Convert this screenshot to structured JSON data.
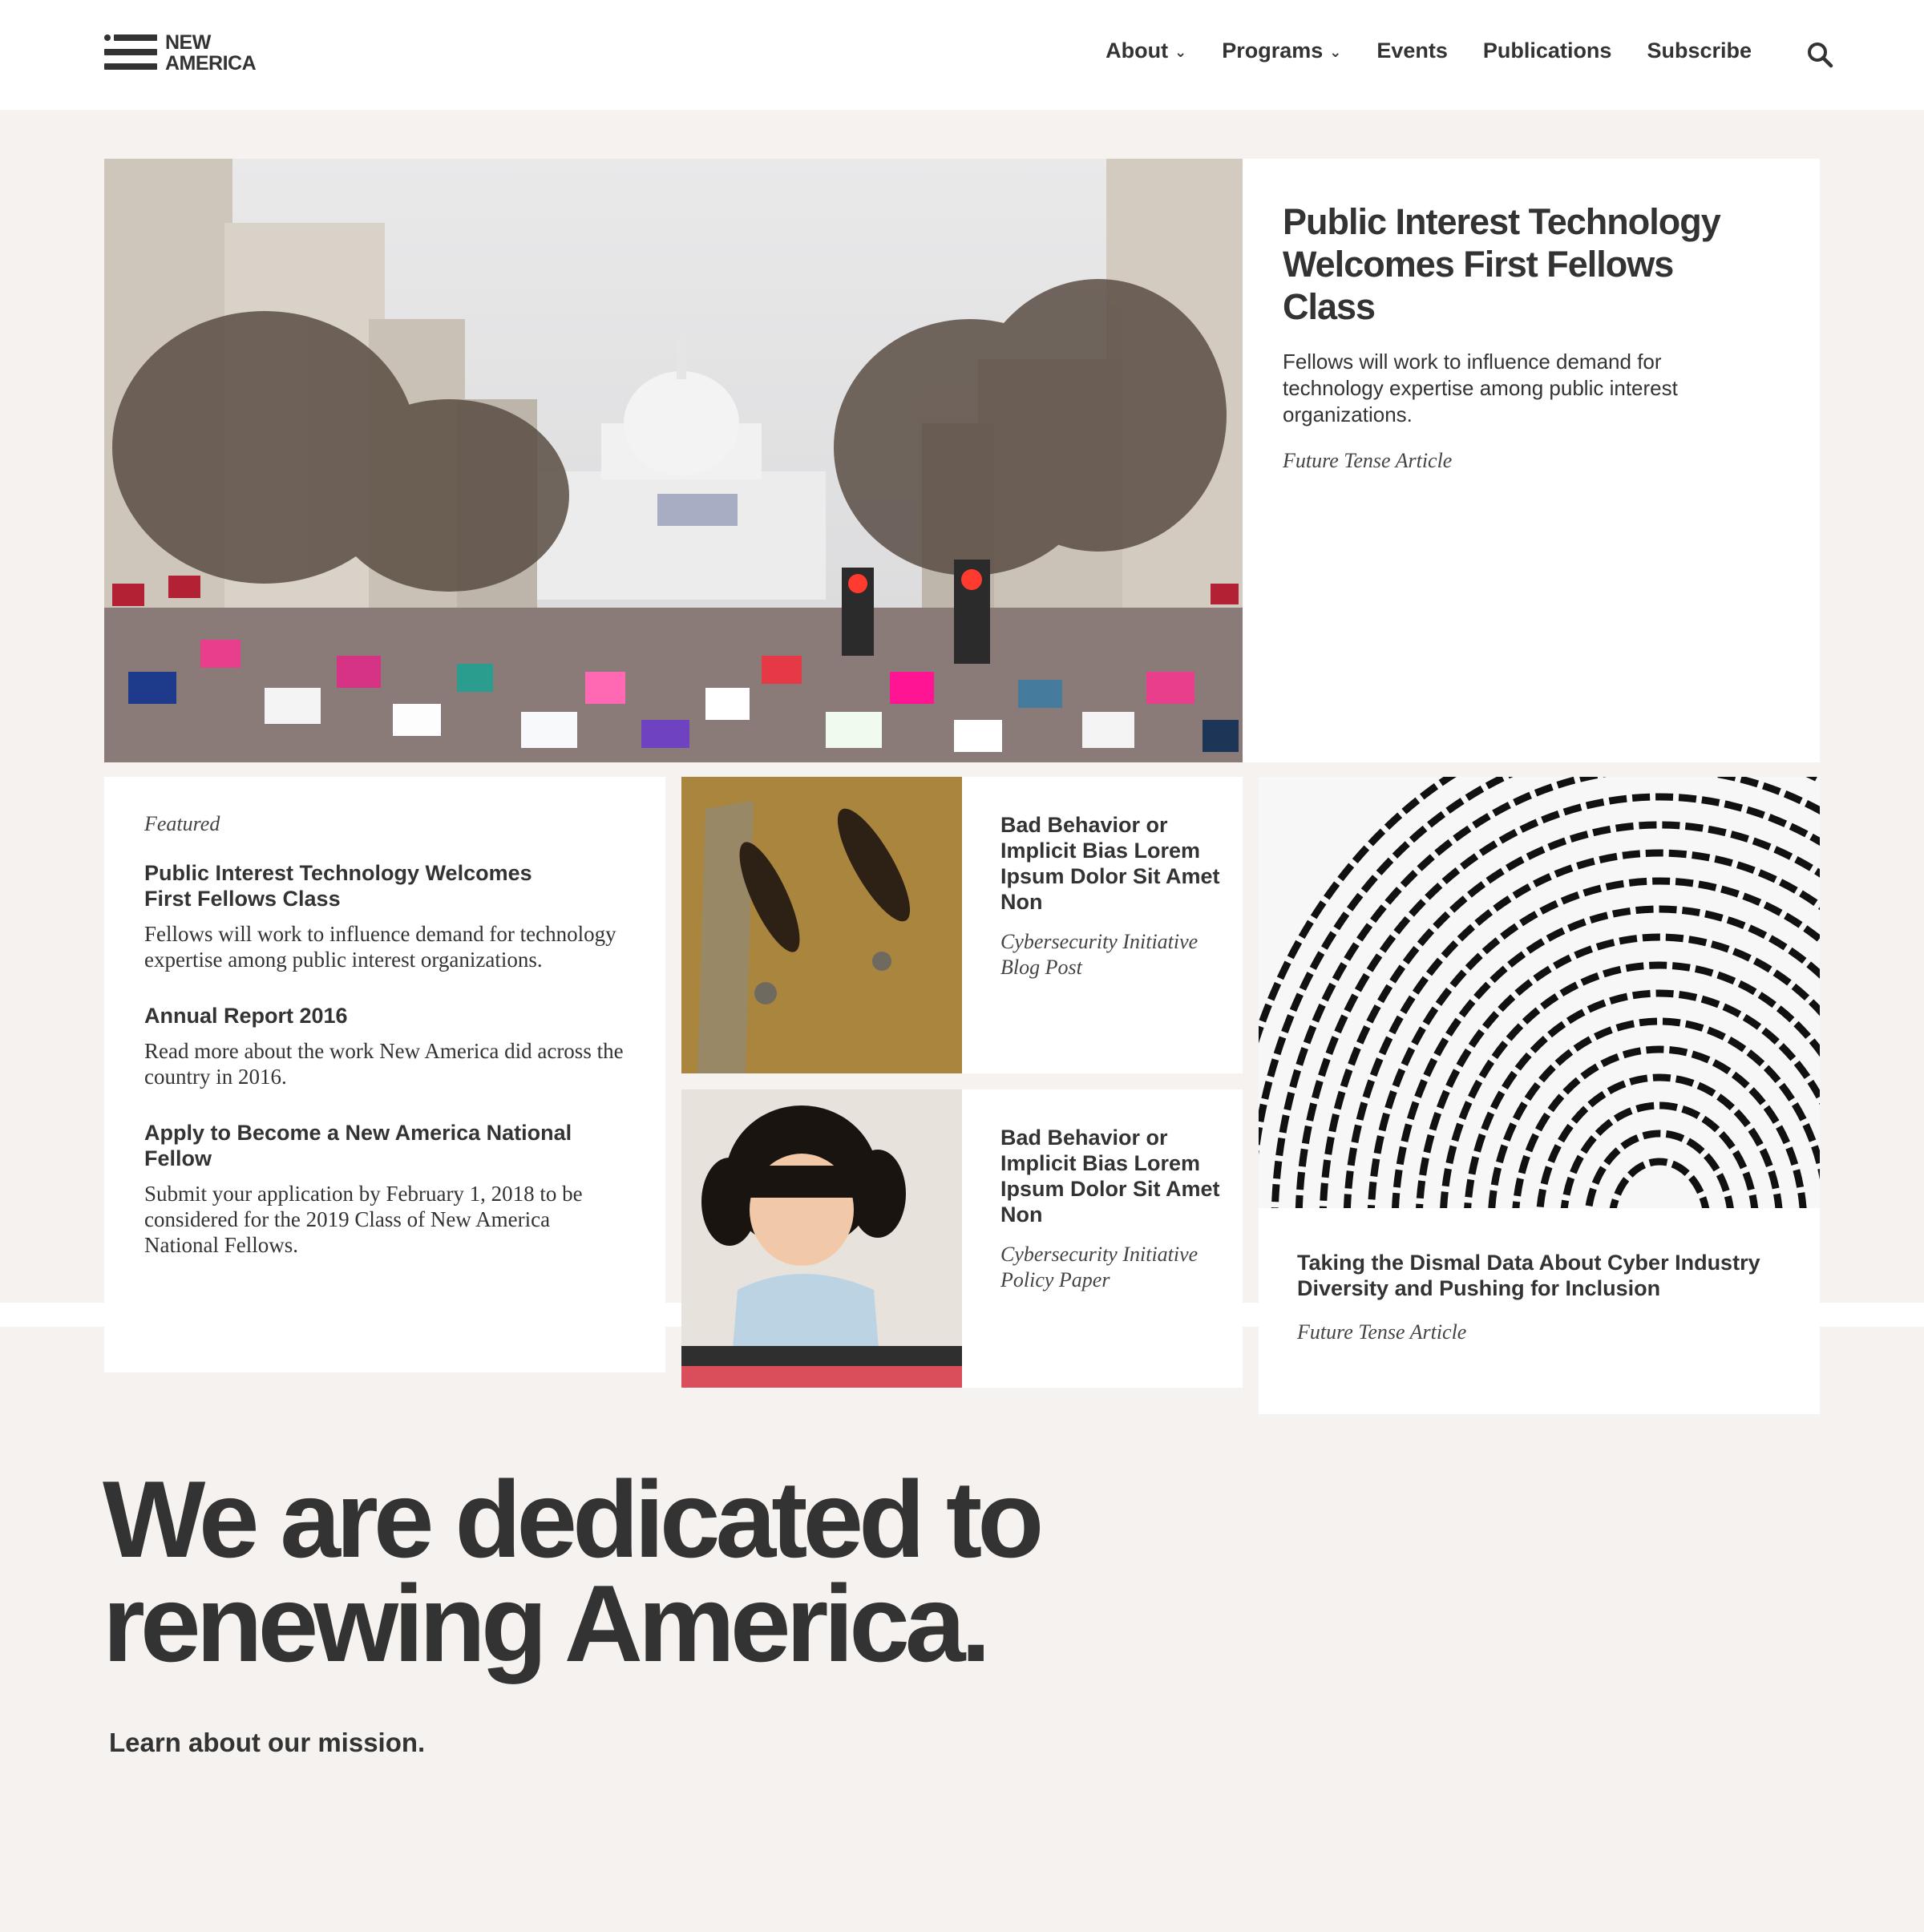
{
  "header": {
    "logo_line1": "NEW",
    "logo_line2": "AMERICA",
    "nav": [
      {
        "label": "About",
        "has_menu": true
      },
      {
        "label": "Programs",
        "has_menu": true
      },
      {
        "label": "Events",
        "has_menu": false
      },
      {
        "label": "Publications",
        "has_menu": false
      },
      {
        "label": "Subscribe",
        "has_menu": false
      }
    ],
    "search_icon": "search-icon"
  },
  "hero": {
    "title": "Public Interest Technology Welcomes First Fellows Class",
    "description": "Fellows will work to influence demand for technology expertise among public interest organizations.",
    "tag": "Future Tense Article"
  },
  "featured": {
    "label": "Featured",
    "items": [
      {
        "title": "Public Interest Technology Welcomes First Fellows Class",
        "description": "Fellows will work to influence demand for technology expertise among public interest organizations."
      },
      {
        "title": "Annual Report 2016",
        "description": "Read more about the work New America did across the country in 2016."
      },
      {
        "title": "Apply to Become a New America National Fellow",
        "description": "Submit your application by February 1, 2018 to be considered for the 2019 Class of New America National Fellows."
      }
    ]
  },
  "cards": [
    {
      "title": "Bad Behavior or Implicit Bias Lorem Ipsum Dolor Sit Amet Non",
      "tag_line1": "Cybersecurity Initiative",
      "tag_line2": "Blog Post"
    },
    {
      "title": "Bad Behavior or Implicit Bias Lorem Ipsum Dolor Sit Amet Non",
      "tag_line1": "Cybersecurity Initiative",
      "tag_line2": "Policy Paper"
    }
  ],
  "right_card": {
    "title": "Taking the Dismal Data About Cyber Industry Diversity and Pushing for Inclusion",
    "tag": "Future Tense Article"
  },
  "mission": {
    "line1": "We are dedicated to",
    "line2": "renewing America.",
    "link": "Learn about our mission."
  },
  "colors": {
    "background": "#f5f2ef",
    "text": "#333333",
    "card": "#ffffff"
  }
}
